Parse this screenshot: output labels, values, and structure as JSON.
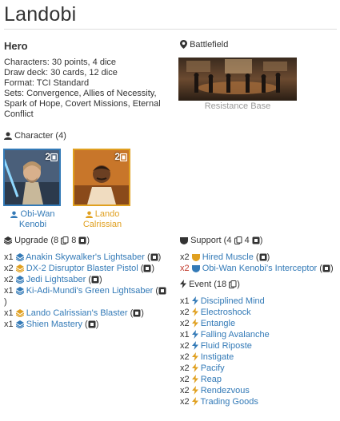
{
  "title": "Landobi",
  "affiliation": "Hero",
  "meta": [
    "Characters: 30 points, 4 dice",
    "Draw deck: 30 cards, 12 dice",
    "Format: TCI Standard",
    "Sets: Convergence, Allies of Necessity,",
    "Spark of Hope, Covert Missions, Eternal",
    "Conflict"
  ],
  "battlefield": {
    "heading": "Battlefield",
    "name": "Resistance Base"
  },
  "characters": {
    "heading": "Character",
    "count": "(4)",
    "cards": [
      {
        "name_line1": "Obi-Wan",
        "name_line2": "Kenobi",
        "badge": "2",
        "color": "#337ab7"
      },
      {
        "name_line1": "Lando",
        "name_line2": "Calrissian",
        "badge": "2",
        "color": "#e0a020"
      }
    ]
  },
  "upgrade": {
    "heading": "Upgrade",
    "count_open": "(8",
    "count_mid": "8",
    "count_close": ")",
    "items": [
      {
        "qty": "x1",
        "name": "Anakin Skywalker's Lightsaber",
        "icon_color": "#337ab7",
        "die": true
      },
      {
        "qty": "x2",
        "name": "DX-2 Disruptor Blaster Pistol",
        "icon_color": "#e0a020",
        "die": true
      },
      {
        "qty": "x2",
        "name": "Jedi Lightsaber",
        "icon_color": "#337ab7",
        "die": true
      },
      {
        "qty": "x1",
        "name": "Ki-Adi-Mundi's Green Lightsaber",
        "icon_color": "#337ab7",
        "die": true
      },
      {
        "qty": "x1",
        "name": "Lando Calrissian's Blaster",
        "icon_color": "#e0a020",
        "die": true
      },
      {
        "qty": "x1",
        "name": "Shien Mastery",
        "icon_color": "#337ab7",
        "die": true
      }
    ]
  },
  "support": {
    "heading": "Support",
    "count_open": "(4",
    "count_mid": "4",
    "count_close": ")",
    "items": [
      {
        "qty": "x2",
        "name": "Hired Muscle",
        "icon_color": "#e0a020",
        "qty_red": false
      },
      {
        "qty": "x2",
        "name": "Obi-Wan Kenobi's Interceptor",
        "icon_color": "#337ab7",
        "qty_red": true
      }
    ]
  },
  "event": {
    "heading": "Event",
    "count_open": "(18",
    "count_close": ")",
    "items": [
      {
        "qty": "x1",
        "name": "Disciplined Mind",
        "icon_color": "#337ab7"
      },
      {
        "qty": "x2",
        "name": "Electroshock",
        "icon_color": "#e0a020"
      },
      {
        "qty": "x2",
        "name": "Entangle",
        "icon_color": "#e0a020"
      },
      {
        "qty": "x1",
        "name": "Falling Avalanche",
        "icon_color": "#337ab7"
      },
      {
        "qty": "x2",
        "name": "Fluid Riposte",
        "icon_color": "#337ab7"
      },
      {
        "qty": "x2",
        "name": "Instigate",
        "icon_color": "#e0a020"
      },
      {
        "qty": "x2",
        "name": "Pacify",
        "icon_color": "#e0a020"
      },
      {
        "qty": "x2",
        "name": "Reap",
        "icon_color": "#e0a020"
      },
      {
        "qty": "x2",
        "name": "Rendezvous",
        "icon_color": "#e0a020"
      },
      {
        "qty": "x2",
        "name": "Trading Goods",
        "icon_color": "#e0a020"
      }
    ]
  }
}
